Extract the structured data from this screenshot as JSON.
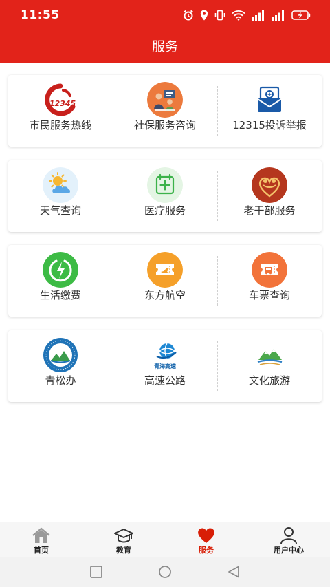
{
  "status": {
    "time": "11:55"
  },
  "header": {
    "title": "服务"
  },
  "colors": {
    "brand_red": "#e2231a",
    "active_tab": "#d81e06"
  },
  "grid": [
    [
      {
        "label": "市民服务热线",
        "icon": "hotline-12345-icon",
        "badge": "12345"
      },
      {
        "label": "社保服务咨询",
        "icon": "social-security-icon"
      },
      {
        "label": "12315投诉举报",
        "icon": "complaint-mail-icon"
      }
    ],
    [
      {
        "label": "天气查询",
        "icon": "weather-icon"
      },
      {
        "label": "医疗服务",
        "icon": "medical-icon"
      },
      {
        "label": "老干部服务",
        "icon": "veteran-cadre-icon"
      }
    ],
    [
      {
        "label": "生活缴费",
        "icon": "bill-payment-icon"
      },
      {
        "label": "东方航空",
        "icon": "airline-ticket-icon"
      },
      {
        "label": "车票查询",
        "icon": "train-ticket-icon"
      }
    ],
    [
      {
        "label": "青松办",
        "icon": "qingsongban-emblem-icon"
      },
      {
        "label": "高速公路",
        "icon": "highway-globe-icon",
        "logo_text": "青海高速"
      },
      {
        "label": "文化旅游",
        "icon": "culture-tourism-icon"
      }
    ]
  ],
  "tabs": [
    {
      "label": "首页",
      "icon": "home-icon",
      "active": false
    },
    {
      "label": "教育",
      "icon": "graduation-cap-icon",
      "active": false
    },
    {
      "label": "服务",
      "icon": "heart-icon",
      "active": true
    },
    {
      "label": "用户中心",
      "icon": "user-icon",
      "active": false
    }
  ],
  "system_nav": [
    "recent-apps-button",
    "home-button",
    "back-button"
  ]
}
